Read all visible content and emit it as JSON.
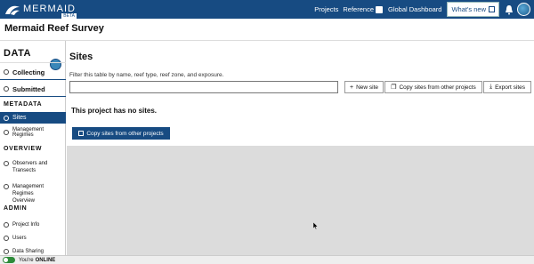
{
  "topbar": {
    "logo_text": "MERMAID",
    "logo_badge": "BETA",
    "nav_projects": "Projects",
    "nav_reference": "Reference",
    "nav_dashboard": "Global Dashboard",
    "whats_new": "What's new",
    "accent_color": "#174b82"
  },
  "project": {
    "title": "Mermaid Reef Survey"
  },
  "sidebar": {
    "data_heading": "DATA",
    "collecting": "Collecting",
    "submitted": "Submitted",
    "metadata_heading": "METADATA",
    "sites": "Sites",
    "management_regimes": "Management Regimes",
    "overview_heading": "OVERVIEW",
    "observers_transects_1": "Observers and",
    "observers_transects_2": "Transects",
    "mgmt_overview_1": "Management Regimes",
    "mgmt_overview_2": "Overview",
    "admin_heading": "ADMIN",
    "project_info": "Project Info",
    "users": "Users",
    "data_sharing": "Data Sharing"
  },
  "status": {
    "prefix": "You're",
    "state": "ONLINE"
  },
  "main": {
    "heading": "Sites",
    "filter_label": "Filter this table by name, reef type, reef zone, and exposure.",
    "new_site": "New site",
    "copy_sites": "Copy sites from other projects",
    "export_sites": "Export sites",
    "empty_message": "This project has no sites.",
    "copy_sites_primary": "Copy sites from other projects"
  }
}
